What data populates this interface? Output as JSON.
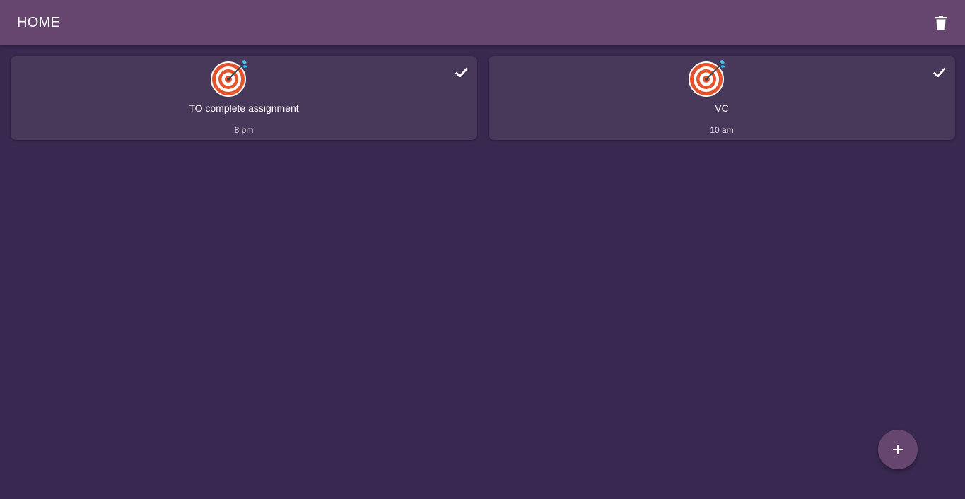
{
  "app_bar": {
    "title": "HOME",
    "delete_icon": "trash-icon"
  },
  "tasks": [
    {
      "title": "TO complete assignment",
      "time": "8 pm",
      "icon": "target-dart-icon",
      "action_icon": "check-icon"
    },
    {
      "title": "VC",
      "time": "10 am",
      "icon": "target-dart-icon",
      "action_icon": "check-icon"
    }
  ],
  "fab": {
    "icon": "plus-icon"
  },
  "colors": {
    "background": "#392850",
    "app_bar": "#66466f",
    "card": "#48385a",
    "target_red": "#e5532c",
    "dart_blue": "#4fc3f7"
  }
}
